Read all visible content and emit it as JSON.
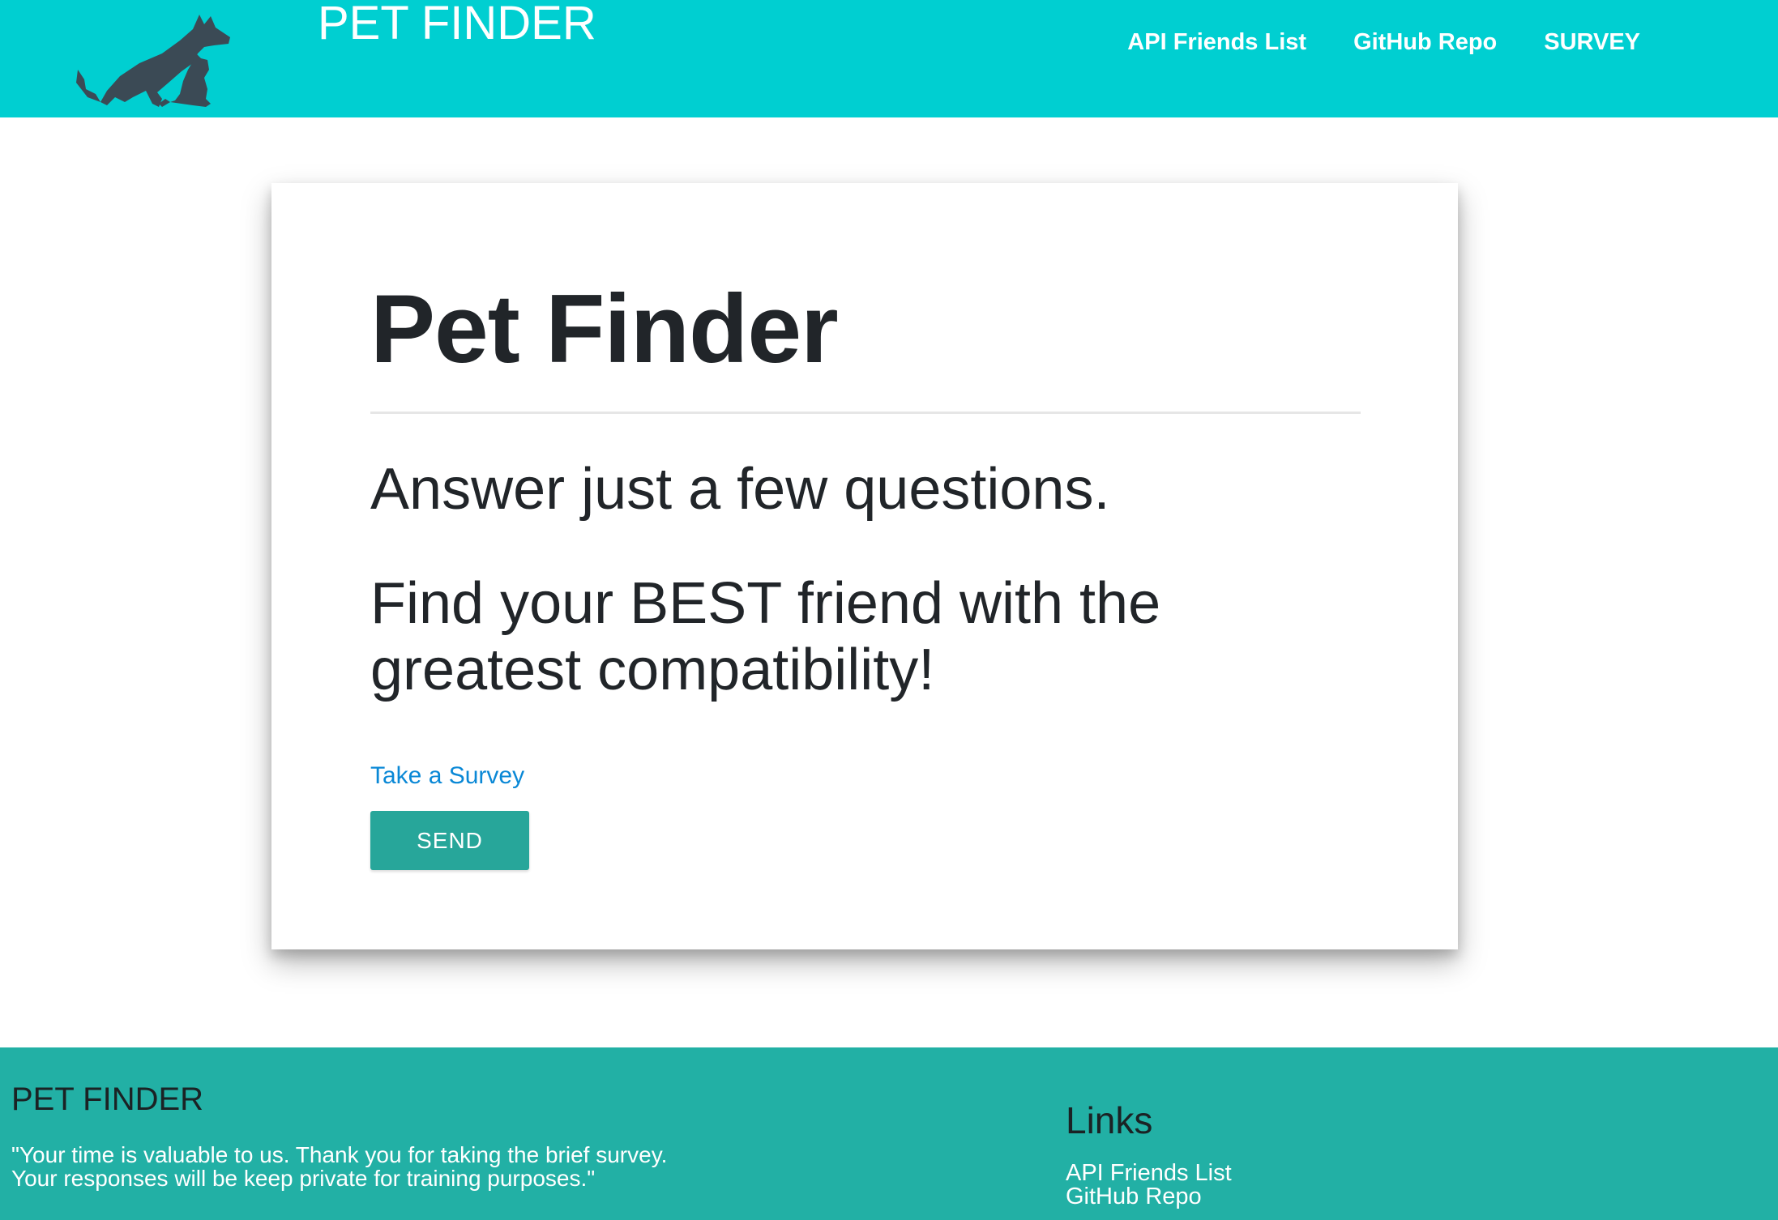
{
  "navbar": {
    "brand": "PET FINDER",
    "logo_icon": "dog-and-cat-silhouette-icon",
    "links": [
      {
        "label": "API Friends List"
      },
      {
        "label": "GitHub Repo"
      },
      {
        "label": "SURVEY"
      }
    ]
  },
  "card": {
    "title": "Pet Finder",
    "lead1": "Answer just a few questions.",
    "lead2": "Find your BEST friend with the greatest compatibility!",
    "survey_link": "Take a Survey",
    "send_label": "SEND"
  },
  "footer": {
    "title": "PET FINDER",
    "text_line1": "\"Your time is valuable to us. Thank you for taking the brief survey.",
    "text_line2": "Your responses will be keep private for training purposes.\"",
    "links_title": "Links",
    "links": [
      {
        "label": "API Friends List"
      },
      {
        "label": "GitHub Repo"
      }
    ]
  },
  "colors": {
    "navbar": "#00cfd1",
    "footer": "#22b0a5",
    "button": "#27a69a",
    "link": "#0a88d6",
    "logo": "#3b4a55"
  }
}
